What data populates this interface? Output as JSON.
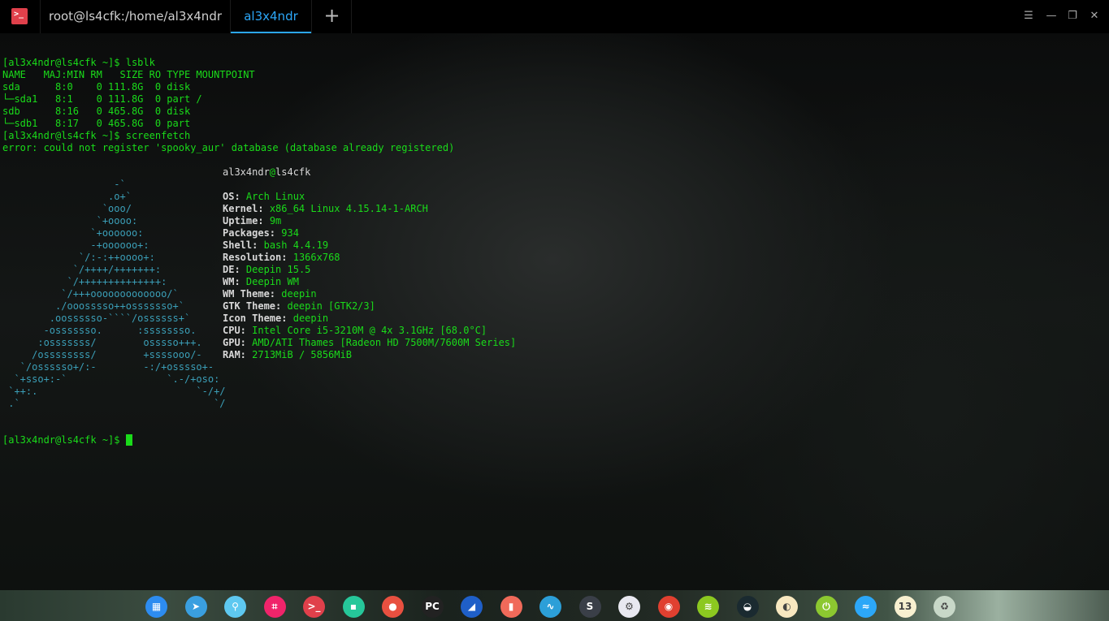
{
  "window": {
    "tabs": [
      {
        "label": "root@ls4cfk:/home/al3x4ndr"
      },
      {
        "label": "al3x4ndr",
        "active": true
      }
    ],
    "app_icon": "terminal-icon",
    "accent": "#2ca7f8"
  },
  "terminal": {
    "lines": [
      "[al3x4ndr@ls4cfk ~]$ lsblk",
      "NAME   MAJ:MIN RM   SIZE RO TYPE MOUNTPOINT",
      "sda      8:0    0 111.8G  0 disk ",
      "└─sda1   8:1    0 111.8G  0 part /",
      "sdb      8:16   0 465.8G  0 disk ",
      "└─sdb1   8:17   0 465.8G  0 part ",
      "[al3x4ndr@ls4cfk ~]$ screenfetch",
      "error: could not register 'spooky_aur' database (database already registered)"
    ],
    "ascii_logo": [
      "                   -`",
      "                  .o+`",
      "                 `ooo/",
      "                `+oooo:",
      "               `+oooooo:",
      "               -+oooooo+:",
      "             `/:-:++oooo+:",
      "            `/++++/+++++++:",
      "           `/++++++++++++++:",
      "          `/+++ooooooooooooo/`",
      "         ./ooosssso++osssssso+`",
      "        .oossssso-````/ossssss+`",
      "       -osssssso.      :ssssssso.",
      "      :osssssss/        osssso+++.",
      "     /ossssssss/        +ssssooo/-",
      "   `/ossssso+/:-        -:/+osssso+-",
      "  `+sso+:-`                 `.-/+oso:",
      " `++:.                           `-/+/",
      " .`                                 `/"
    ],
    "info_user": "al3x4ndr",
    "info_host": "ls4cfk",
    "info": [
      {
        "label": "OS:",
        "value": "Arch Linux"
      },
      {
        "label": "Kernel:",
        "value": "x86_64 Linux 4.15.14-1-ARCH"
      },
      {
        "label": "Uptime:",
        "value": "9m"
      },
      {
        "label": "Packages:",
        "value": "934"
      },
      {
        "label": "Shell:",
        "value": "bash 4.4.19"
      },
      {
        "label": "Resolution:",
        "value": "1366x768"
      },
      {
        "label": "DE:",
        "value": "Deepin 15.5"
      },
      {
        "label": "WM:",
        "value": "Deepin WM"
      },
      {
        "label": "WM Theme:",
        "value": "deepin"
      },
      {
        "label": "GTK Theme:",
        "value": "deepin [GTK2/3]"
      },
      {
        "label": "Icon Theme:",
        "value": "deepin"
      },
      {
        "label": "CPU:",
        "value": "Intel Core i5-3210M @ 4x 3.1GHz [68.0°C]"
      },
      {
        "label": "GPU:",
        "value": "AMD/ATI Thames [Radeon HD 7500M/7600M Series]"
      },
      {
        "label": "RAM:",
        "value": "2713MiB / 5856MiB"
      }
    ],
    "prompt": "[al3x4ndr@ls4cfk ~]$ "
  },
  "dock": [
    {
      "name": "launcher-icon",
      "glyph": "▦",
      "color": "#2d8cf0"
    },
    {
      "name": "telegram-icon",
      "glyph": "➤",
      "color": "#3a9fe0"
    },
    {
      "name": "file-manager-icon",
      "glyph": "⚲",
      "color": "#5ec8f0"
    },
    {
      "name": "screenshot-icon",
      "glyph": "⌗",
      "color": "#f0246a"
    },
    {
      "name": "terminal-icon",
      "glyph": ">_",
      "color": "#e0404b"
    },
    {
      "name": "editor-icon",
      "glyph": "▪",
      "color": "#26c79a"
    },
    {
      "name": "bulb-icon",
      "glyph": "●",
      "color": "#e85040"
    },
    {
      "name": "pycharm-icon",
      "glyph": "PC",
      "color": "#222222"
    },
    {
      "name": "wireshark-icon",
      "glyph": "◢",
      "color": "#1f5fc8"
    },
    {
      "name": "screen-recorder-icon",
      "glyph": "▮",
      "color": "#f06a5a"
    },
    {
      "name": "system-monitor-icon",
      "glyph": "∿",
      "color": "#2c9fd8"
    },
    {
      "name": "sublime-icon",
      "glyph": "S",
      "color": "#3a3f48"
    },
    {
      "name": "settings-icon",
      "glyph": "⚙",
      "color": "#e8e8f0"
    },
    {
      "name": "chrome-icon",
      "glyph": "◉",
      "color": "#e04030"
    },
    {
      "name": "spotify-icon",
      "glyph": "≋",
      "color": "#8cc820"
    },
    {
      "name": "network-icon",
      "glyph": "◒",
      "color": "#1a2a30"
    },
    {
      "name": "notes-icon",
      "glyph": "◐",
      "color": "#f8e8c0"
    },
    {
      "name": "power-icon",
      "glyph": "⏻",
      "color": "#8cc830"
    },
    {
      "name": "wifi-icon",
      "glyph": "≈",
      "color": "#2ca7f8"
    },
    {
      "name": "clock-icon",
      "glyph": "13",
      "color": "#f8f0d0"
    },
    {
      "name": "trash-icon",
      "glyph": "♻",
      "color": "#c8d8c8"
    }
  ]
}
